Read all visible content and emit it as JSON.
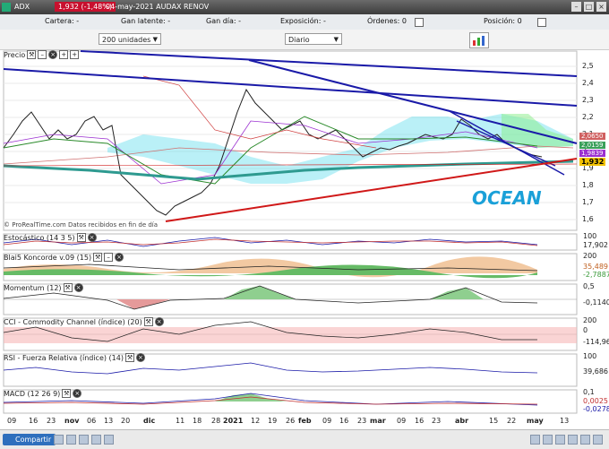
{
  "titlebar": {
    "symbol": "ADX",
    "price_change": "1,932 (-1,48%)",
    "date_name": "04-may-2021 AUDAX RENOV"
  },
  "infobar": {
    "cartera": "Cartera: -",
    "ganancia_latente": "Gan latente: -",
    "ganancia_dia": "Gan día: -",
    "exposicion": "Exposición: -",
    "ordenes": "Órdenes: 0",
    "posicion": "Posición: 0"
  },
  "toolbar": {
    "units": "200 unidades",
    "period": "Diario"
  },
  "panels": {
    "precio": "Precio",
    "estocastico": "Estocástico (14 3 5)",
    "koncorde": "Blai5 Koncorde v.09 (15)",
    "momentum": "Momentum (12)",
    "cci": "CCI - Commodity Channel (índice) (20)",
    "rsi": "RSI - Fuerza Relativa (índice) (14)",
    "macd": "MACD (12 26 9)"
  },
  "price_axis": [
    "2,5",
    "2,4",
    "2,3",
    "2,2",
    "2,1",
    "2",
    "1,9",
    "1,8",
    "1,7",
    "1,6"
  ],
  "price_tags": {
    "last": "1,932",
    "t1": "2,0650",
    "t2": "2,0159",
    "t3": "1,9839"
  },
  "indicator_values": {
    "estocastico_top": "100",
    "estocastico_val": "17,902",
    "koncorde_top": "200",
    "koncorde_val": "35,489",
    "koncorde_low": "-2,7887",
    "momentum_top": "0,5",
    "momentum_val": "-0,1140",
    "cci_top": "200",
    "cci_zero": "0",
    "cci_val": "-114,96",
    "rsi_top": "100",
    "rsi_val": "39,686",
    "macd_top": "0,1",
    "macd_val1": "0,0025",
    "macd_val2": "-0,0278"
  },
  "x_axis": [
    "09",
    "16",
    "23",
    "nov",
    "06",
    "13",
    "20",
    "dic",
    "11",
    "18",
    "28",
    "2021",
    "12",
    "19",
    "26",
    "feb",
    "09",
    "16",
    "23",
    "mar",
    "09",
    "16",
    "23",
    "abr",
    "15",
    "22",
    "may",
    "13"
  ],
  "watermark": "OCEAN",
  "copyright": "© ProRealTime.com  Datos recibidos en fin de día",
  "footer": {
    "share": "Compartir"
  },
  "colors": {
    "down_tag": "#c8102e",
    "trend_blue": "#1a1aa8",
    "trend_red": "#d01818",
    "cloud": "#66ddee",
    "teal_ma": "#2e9a90"
  }
}
